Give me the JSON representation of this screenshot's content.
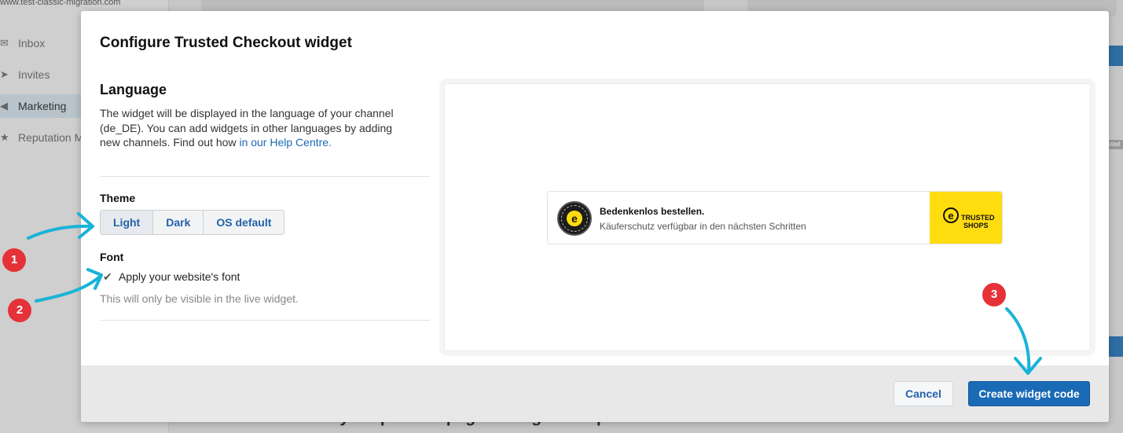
{
  "background": {
    "url_fragment": "www.test-classic-migration.com",
    "nav_items": [
      {
        "icon": "inbox-icon",
        "glyph": "✉",
        "label": "Inbox",
        "active": false
      },
      {
        "icon": "send-icon",
        "glyph": "➤",
        "label": "Invites",
        "active": false
      },
      {
        "icon": "megaphone-icon",
        "glyph": "◀",
        "label": "Marketing",
        "active": true
      },
      {
        "icon": "star-icon",
        "glyph": "★",
        "label": "Reputation M",
        "active": false
      }
    ],
    "headline": "Make the most of your product pages: widgets for product reviews",
    "side_tag": "sted"
  },
  "modal": {
    "title": "Configure Trusted Checkout widget",
    "language": {
      "heading": "Language",
      "description": "The widget will be displayed in the language of your channel (de_DE). You can add widgets in other languages by adding new channels. Find out how ",
      "help_link": "in our Help Centre."
    },
    "theme": {
      "label": "Theme",
      "options": [
        "Light",
        "Dark",
        "OS default"
      ],
      "selected": "Light"
    },
    "font": {
      "label": "Font",
      "option_label": "Apply your website's font",
      "checked": true,
      "hint": "This will only be visible in the live widget."
    },
    "preview": {
      "title": "Bedenkenlos bestellen.",
      "subtitle": "Käuferschutz verfügbar in den nächsten Schritten",
      "logo_text_1": "TRUSTED",
      "logo_text_2": "SHOPS",
      "logo_letter": "e",
      "logo_color": "#ffdc0f"
    },
    "footer": {
      "cancel_label": "Cancel",
      "create_label": "Create widget code"
    }
  },
  "annotations": {
    "badges": [
      "1",
      "2",
      "3"
    ],
    "badge_color": "#e53238",
    "arrow_color": "#19b3d8"
  }
}
